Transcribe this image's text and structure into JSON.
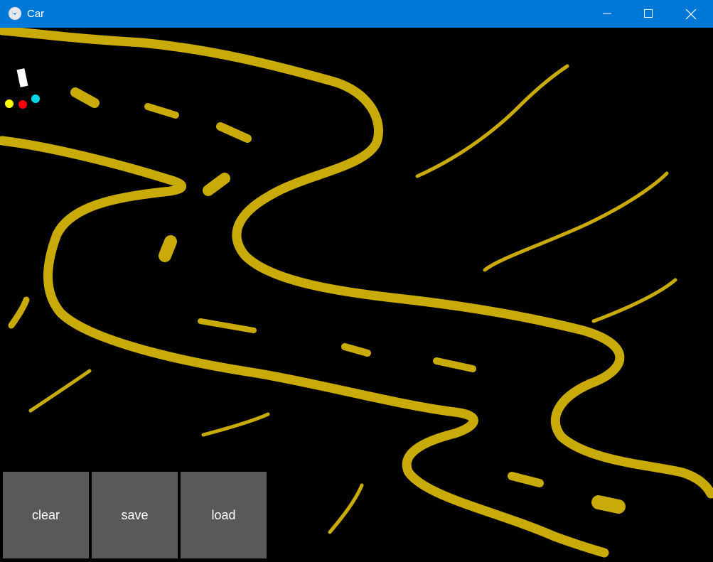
{
  "window": {
    "title": "Car"
  },
  "buttons": {
    "clear": "clear",
    "save": "save",
    "load": "load"
  },
  "colors": {
    "road": "#c8aa08",
    "sensor_left": "#ffff00",
    "sensor_center": "#ff0000",
    "sensor_right": "#00d6e6",
    "car": "#ffffff",
    "titlebar": "#0078d7",
    "button": "#595959"
  },
  "icons": {
    "app": "kivy-icon",
    "minimize": "minimize-icon",
    "maximize": "maximize-icon",
    "close": "close-icon"
  }
}
